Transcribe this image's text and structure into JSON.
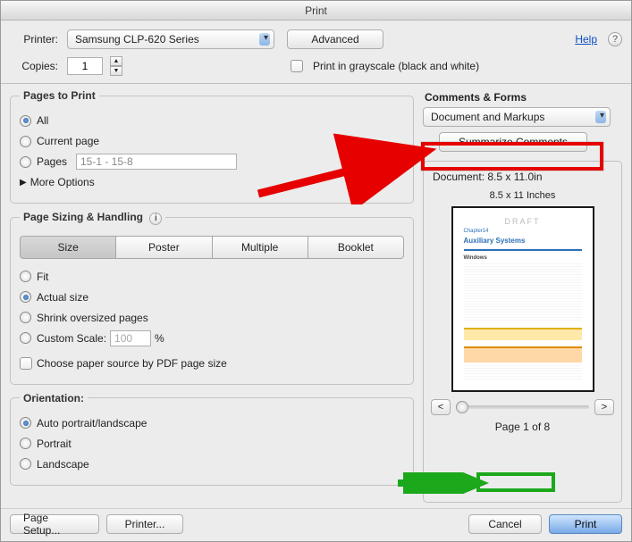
{
  "window": {
    "title": "Print"
  },
  "help": {
    "label": "Help"
  },
  "printer": {
    "label": "Printer:",
    "selected": "Samsung CLP-620 Series",
    "advanced": "Advanced"
  },
  "copies": {
    "label": "Copies:",
    "value": "1",
    "grayscale_label": "Print in grayscale (black and white)"
  },
  "pages": {
    "legend": "Pages to Print",
    "all": "All",
    "current": "Current page",
    "pages": "Pages",
    "range_placeholder": "15-1 - 15-8",
    "more": "More Options"
  },
  "sizing": {
    "legend": "Page Sizing & Handling",
    "tabs": {
      "size": "Size",
      "poster": "Poster",
      "multiple": "Multiple",
      "booklet": "Booklet"
    },
    "fit": "Fit",
    "actual": "Actual size",
    "shrink": "Shrink oversized pages",
    "custom": "Custom Scale:",
    "custom_value": "100",
    "custom_unit": "%",
    "choose_source": "Choose paper source by PDF page size"
  },
  "orientation": {
    "legend": "Orientation:",
    "auto": "Auto portrait/landscape",
    "portrait": "Portrait",
    "landscape": "Landscape"
  },
  "comments": {
    "legend": "Comments & Forms",
    "selected": "Document and Markups",
    "summarize": "Summarize Comments"
  },
  "preview": {
    "doc_dim": "Document: 8.5 x 11.0in",
    "page_dim": "8.5 x 11 Inches",
    "draft": "DRAFT",
    "chapter": "Chapter14",
    "doc_title": "Auxiliary Systems",
    "section": "Windows",
    "warning": "WARNING",
    "caution": "CAUTION",
    "prev": "<",
    "next": ">",
    "page_label": "Page 1 of 8"
  },
  "footer": {
    "page_setup": "Page Setup...",
    "printer_btn": "Printer...",
    "cancel": "Cancel",
    "print": "Print"
  }
}
